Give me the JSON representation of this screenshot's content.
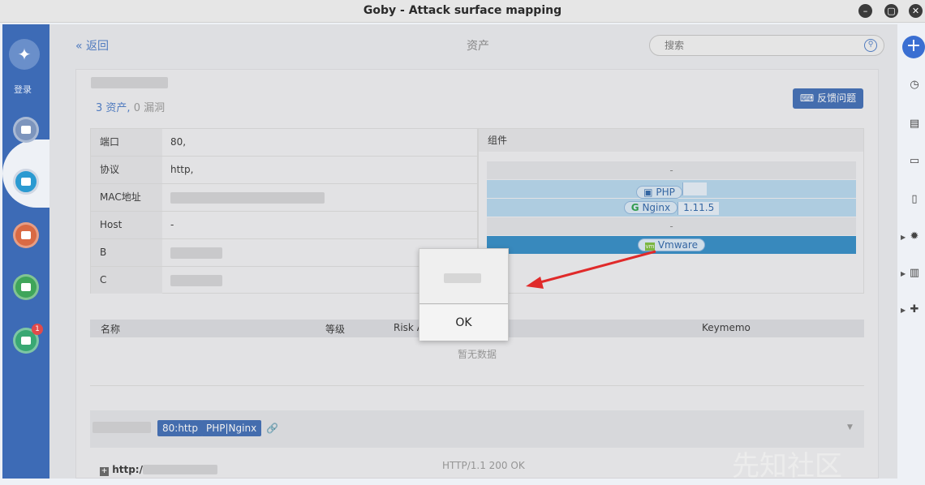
{
  "window": {
    "title": "Goby - Attack surface mapping",
    "controls": [
      "–",
      "▢",
      "✕"
    ]
  },
  "leftnav": {
    "login_label": "登录",
    "badge_count": "1"
  },
  "header": {
    "back_label": "« 返回",
    "page_title": "资产",
    "search_placeholder": "搜索"
  },
  "summary": {
    "assets": "3 资产,",
    "vulns": "0 漏洞"
  },
  "feedback_label": "反馈问题",
  "info": [
    {
      "key": "端口",
      "value": "80,"
    },
    {
      "key": "协议",
      "value": "http,"
    },
    {
      "key": "MAC地址",
      "value": ""
    },
    {
      "key": "Host",
      "value": "-"
    },
    {
      "key": "B",
      "value": ""
    },
    {
      "key": "C",
      "value": ""
    }
  ],
  "components": {
    "header": "组件",
    "rows": [
      {
        "label": "-",
        "version": ""
      },
      {
        "label": "PHP",
        "version": ""
      },
      {
        "label": "Nginx",
        "version": "1.11.5"
      },
      {
        "label": "-",
        "version": ""
      },
      {
        "label": "Vmware",
        "version": ""
      }
    ]
  },
  "vuln_table": {
    "columns": [
      "名称",
      "等级",
      "Risk A",
      "Keymemo"
    ],
    "empty_text": "暂无数据"
  },
  "service": {
    "port_chip": "80:http",
    "tech_chip": "PHP|Nginx",
    "http_label": "http:/",
    "http_status": "HTTP/1.1 200 OK"
  },
  "alert": {
    "ok_label": "OK"
  },
  "watermark": "先知社区",
  "colors": {
    "accent": "#3d6bb6",
    "arrow": "#e02a2a",
    "highlight": "#2f8bc6"
  }
}
